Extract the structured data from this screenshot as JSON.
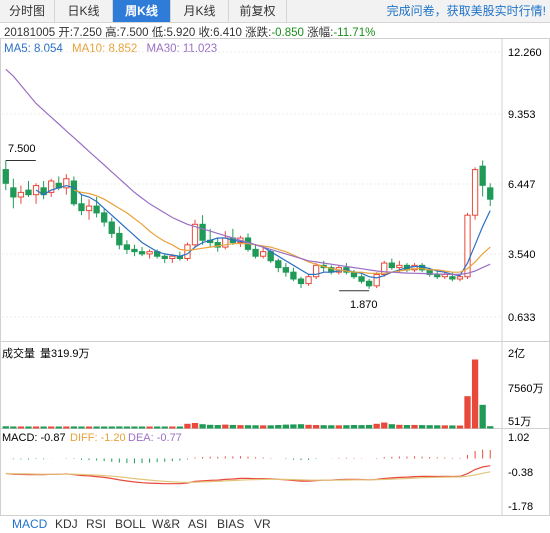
{
  "tabs": [
    {
      "label": "分时图",
      "active": false
    },
    {
      "label": "日K线",
      "active": false
    },
    {
      "label": "周K线",
      "active": true
    },
    {
      "label": "月K线",
      "active": false
    },
    {
      "label": "前复权",
      "active": false
    }
  ],
  "promo_text": "完成问卷，获取美股实时行情!",
  "info": {
    "date": "20181005",
    "open_label": "开:",
    "open": "7.250",
    "high_label": "高:",
    "high": "7.500",
    "low_label": "低:",
    "low": "5.920",
    "close_label": "收:",
    "close": "6.410",
    "change_label": "涨跌:",
    "change": "-0.850",
    "pct_label": "涨幅:",
    "pct": "-11.71%"
  },
  "ma_legend": [
    {
      "label": "MA5: 8.054",
      "color": "#2a6fc2"
    },
    {
      "label": "MA10: 8.852",
      "color": "#e8a23a"
    },
    {
      "label": "MA30: 11.023",
      "color": "#9b6fc4"
    }
  ],
  "colors": {
    "up": "#e8493b",
    "down": "#1f9a57",
    "ma5": "#2a6fc2",
    "ma10": "#e8a23a",
    "ma30": "#9b6fc4",
    "diff": "#e8493b",
    "dea": "#e2c47a",
    "grid": "#e0e0e0"
  },
  "chart_data": [
    {
      "type": "candlestick",
      "title": "周K线",
      "y_ticks": [
        "12.260",
        "9.353",
        "6.447",
        "3.540",
        "0.633"
      ],
      "ylim": [
        0.633,
        12.26
      ],
      "annotations": [
        {
          "text": "7.500",
          "meaning": "high"
        },
        {
          "text": "1.870",
          "meaning": "low"
        }
      ],
      "candles": [
        [
          7.1,
          7.5,
          6.2,
          6.5
        ],
        [
          6.3,
          6.7,
          5.4,
          5.9
        ],
        [
          5.9,
          6.4,
          5.6,
          6.1
        ],
        [
          6.2,
          6.6,
          5.9,
          6.0
        ],
        [
          6.0,
          6.5,
          5.6,
          6.4
        ],
        [
          6.3,
          6.6,
          5.8,
          6.0
        ],
        [
          6.1,
          6.7,
          5.9,
          6.6
        ],
        [
          6.5,
          6.8,
          6.2,
          6.3
        ],
        [
          6.3,
          6.9,
          6.0,
          6.7
        ],
        [
          6.6,
          6.8,
          5.5,
          5.6
        ],
        [
          5.6,
          6.0,
          5.1,
          5.3
        ],
        [
          5.3,
          5.8,
          4.9,
          5.5
        ],
        [
          5.5,
          5.9,
          5.0,
          5.2
        ],
        [
          5.2,
          5.4,
          4.6,
          4.8
        ],
        [
          4.8,
          5.0,
          4.1,
          4.3
        ],
        [
          4.3,
          4.6,
          3.6,
          3.8
        ],
        [
          3.8,
          4.0,
          3.4,
          3.6
        ],
        [
          3.6,
          3.8,
          3.3,
          3.5
        ],
        [
          3.5,
          3.7,
          3.3,
          3.4
        ],
        [
          3.4,
          3.6,
          3.2,
          3.5
        ],
        [
          3.5,
          3.6,
          3.2,
          3.3
        ],
        [
          3.3,
          3.4,
          3.0,
          3.2
        ],
        [
          3.2,
          3.4,
          3.0,
          3.3
        ],
        [
          3.3,
          3.5,
          3.1,
          3.2
        ],
        [
          3.2,
          3.9,
          3.1,
          3.8
        ],
        [
          3.8,
          4.9,
          3.7,
          4.7
        ],
        [
          4.7,
          5.1,
          3.8,
          4.0
        ],
        [
          4.0,
          4.5,
          3.7,
          3.9
        ],
        [
          3.9,
          4.1,
          3.5,
          3.7
        ],
        [
          3.7,
          4.4,
          3.6,
          4.1
        ],
        [
          4.1,
          4.5,
          3.8,
          3.9
        ],
        [
          3.9,
          4.2,
          3.7,
          4.1
        ],
        [
          4.1,
          4.3,
          3.5,
          3.6
        ],
        [
          3.6,
          3.8,
          3.2,
          3.3
        ],
        [
          3.3,
          3.7,
          3.2,
          3.5
        ],
        [
          3.5,
          3.6,
          3.0,
          3.1
        ],
        [
          3.1,
          3.2,
          2.6,
          2.8
        ],
        [
          2.8,
          3.0,
          2.4,
          2.6
        ],
        [
          2.6,
          2.8,
          2.2,
          2.3
        ],
        [
          2.3,
          2.4,
          1.9,
          2.1
        ],
        [
          2.1,
          2.5,
          2.0,
          2.4
        ],
        [
          2.4,
          3.0,
          2.3,
          2.9
        ],
        [
          2.9,
          3.1,
          2.6,
          2.8
        ],
        [
          2.8,
          2.9,
          2.5,
          2.6
        ],
        [
          2.6,
          2.9,
          2.5,
          2.8
        ],
        [
          2.8,
          3.0,
          2.5,
          2.6
        ],
        [
          2.6,
          2.7,
          2.3,
          2.4
        ],
        [
          2.4,
          2.5,
          2.1,
          2.2
        ],
        [
          2.2,
          2.3,
          1.87,
          2.0
        ],
        [
          2.0,
          2.6,
          1.9,
          2.5
        ],
        [
          2.5,
          3.1,
          2.4,
          3.0
        ],
        [
          3.0,
          3.2,
          2.7,
          2.8
        ],
        [
          2.8,
          3.1,
          2.6,
          2.9
        ],
        [
          2.9,
          3.0,
          2.6,
          2.7
        ],
        [
          2.7,
          3.0,
          2.6,
          2.9
        ],
        [
          2.9,
          3.0,
          2.6,
          2.7
        ],
        [
          2.7,
          2.8,
          2.4,
          2.5
        ],
        [
          2.5,
          2.7,
          2.3,
          2.4
        ],
        [
          2.4,
          2.6,
          2.3,
          2.5
        ],
        [
          2.4,
          2.6,
          2.2,
          2.3
        ],
        [
          2.3,
          2.5,
          2.2,
          2.4
        ],
        [
          2.4,
          5.2,
          2.3,
          5.1
        ],
        [
          5.1,
          7.2,
          4.9,
          7.1
        ],
        [
          7.25,
          7.5,
          5.92,
          6.41
        ],
        [
          6.3,
          6.5,
          5.5,
          5.8
        ]
      ],
      "ma_series": [
        {
          "name": "MA5",
          "values": [
            null,
            null,
            null,
            null,
            6.2,
            6.0,
            6.2,
            6.3,
            6.4,
            6.3,
            6.0,
            5.9,
            5.7,
            5.4,
            5.1,
            4.8,
            4.5,
            4.2,
            3.9,
            3.7,
            3.5,
            3.4,
            3.35,
            3.3,
            3.4,
            3.7,
            3.9,
            4.0,
            4.1,
            4.1,
            4.0,
            3.95,
            3.9,
            3.8,
            3.7,
            3.5,
            3.3,
            3.1,
            2.9,
            2.7,
            2.5,
            2.5,
            2.6,
            2.6,
            2.65,
            2.7,
            2.6,
            2.55,
            2.4,
            2.35,
            2.45,
            2.6,
            2.7,
            2.8,
            2.85,
            2.85,
            2.75,
            2.65,
            2.6,
            2.5,
            2.45,
            3.0,
            3.8,
            4.6,
            5.3
          ]
        },
        {
          "name": "MA10",
          "values": [
            null,
            null,
            null,
            null,
            null,
            null,
            null,
            null,
            null,
            6.2,
            6.1,
            6.05,
            5.95,
            5.8,
            5.6,
            5.4,
            5.2,
            4.95,
            4.7,
            4.4,
            4.15,
            3.95,
            3.8,
            3.6,
            3.55,
            3.6,
            3.65,
            3.7,
            3.75,
            3.8,
            3.85,
            3.85,
            3.85,
            3.8,
            3.75,
            3.7,
            3.6,
            3.5,
            3.35,
            3.2,
            3.05,
            2.95,
            2.85,
            2.75,
            2.7,
            2.65,
            2.6,
            2.6,
            2.55,
            2.55,
            2.55,
            2.6,
            2.65,
            2.7,
            2.75,
            2.75,
            2.7,
            2.7,
            2.65,
            2.6,
            2.6,
            2.75,
            3.05,
            3.4,
            3.7
          ]
        },
        {
          "name": "MA30",
          "values": [
            11.5,
            11.2,
            10.8,
            10.4,
            10.0,
            9.7,
            9.4,
            9.1,
            8.8,
            8.5,
            8.2,
            7.9,
            7.6,
            7.3,
            7.0,
            6.7,
            6.4,
            6.1,
            5.85,
            5.6,
            5.4,
            5.2,
            5.0,
            4.85,
            4.7,
            4.6,
            4.5,
            4.4,
            4.3,
            4.2,
            4.1,
            4.0,
            3.9,
            3.8,
            3.7,
            3.6,
            3.5,
            3.4,
            3.3,
            3.2,
            3.1,
            3.05,
            3.0,
            2.95,
            2.9,
            2.85,
            2.8,
            2.75,
            2.7,
            2.65,
            2.62,
            2.6,
            2.58,
            2.56,
            2.55,
            2.54,
            2.53,
            2.52,
            2.51,
            2.5,
            2.5,
            2.55,
            2.65,
            2.8,
            2.95
          ]
        }
      ]
    },
    {
      "type": "bar",
      "title": "成交量",
      "value_label": "量319.9万",
      "y_ticks": [
        "2亿",
        "7560万",
        "51万"
      ],
      "unit": "万",
      "values": [
        300,
        250,
        220,
        200,
        180,
        210,
        200,
        190,
        230,
        260,
        240,
        230,
        210,
        200,
        220,
        260,
        240,
        230,
        210,
        200,
        190,
        210,
        200,
        220,
        900,
        1100,
        800,
        650,
        600,
        700,
        620,
        580,
        560,
        540,
        520,
        520,
        600,
        700,
        750,
        800,
        650,
        600,
        560,
        540,
        520,
        560,
        600,
        580,
        620,
        900,
        1200,
        800,
        650,
        600,
        620,
        580,
        560,
        540,
        520,
        500,
        480,
        7600,
        16500,
        5500,
        320
      ]
    },
    {
      "type": "macd",
      "label_macd": "MACD: -0.87",
      "label_diff": "DIFF: -1.20",
      "label_dea": "DEA: -0.77",
      "y_ticks": [
        "1.02",
        "-0.38",
        "-1.78"
      ],
      "ylim": [
        -1.78,
        1.02
      ]
    }
  ],
  "indicator_tabs": [
    "MACD",
    "KDJ",
    "RSI",
    "BOLL",
    "W&R",
    "ASI",
    "BIAS",
    "VR"
  ]
}
